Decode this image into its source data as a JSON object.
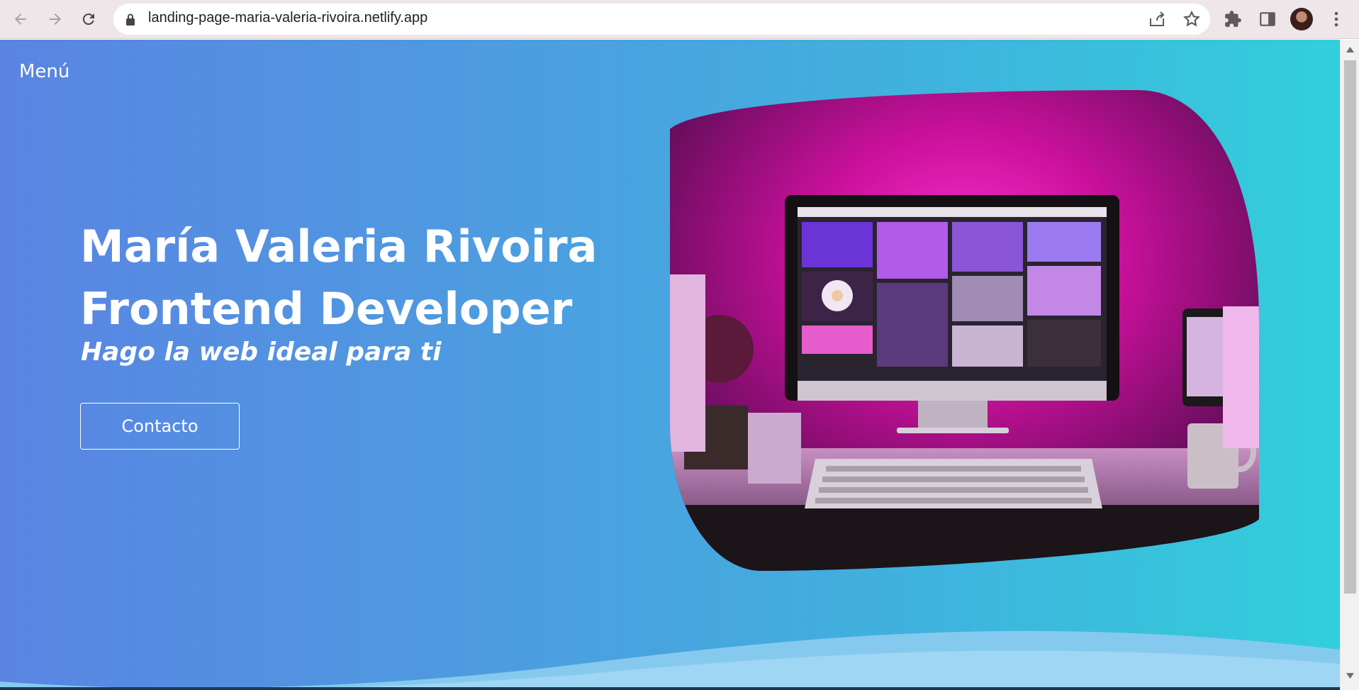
{
  "browser": {
    "url": "landing-page-maria-valeria-rivoira.netlify.app"
  },
  "page": {
    "menu_label": "Menú",
    "title_line1": "María Valeria Rivoira",
    "title_line2": "Frontend Developer",
    "subtitle": "Hago la web ideal para ti",
    "cta_label": "Contacto"
  },
  "colors": {
    "gradient_start": "#5a84e2",
    "gradient_end": "#32cfdb",
    "text": "#ffffff"
  }
}
